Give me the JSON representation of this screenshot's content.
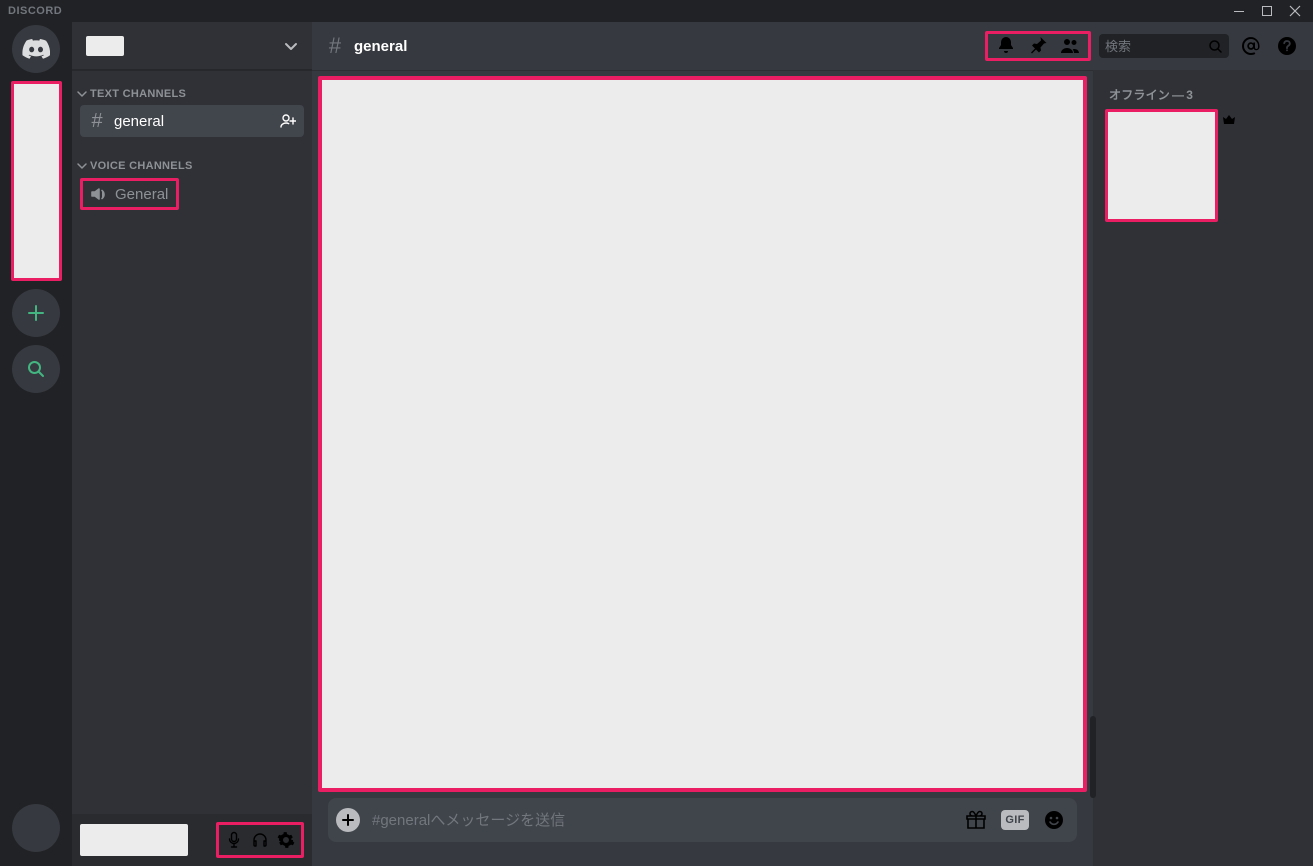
{
  "titlebar": {
    "wordmark": "DISCORD"
  },
  "sidebar": {
    "text_channels_label": "TEXT CHANNELS",
    "voice_channels_label": "VOICE CHANNELS",
    "text_channels": [
      {
        "name": "general",
        "active": true
      }
    ],
    "voice_channels": [
      {
        "name": "General"
      }
    ]
  },
  "header": {
    "channel_name": "general",
    "search_placeholder": "検索"
  },
  "composer": {
    "placeholder": "#generalへメッセージを送信",
    "gif_label": "GIF"
  },
  "members": {
    "offline_label": "オフライン",
    "offline_sep": "—",
    "offline_count": "3"
  }
}
